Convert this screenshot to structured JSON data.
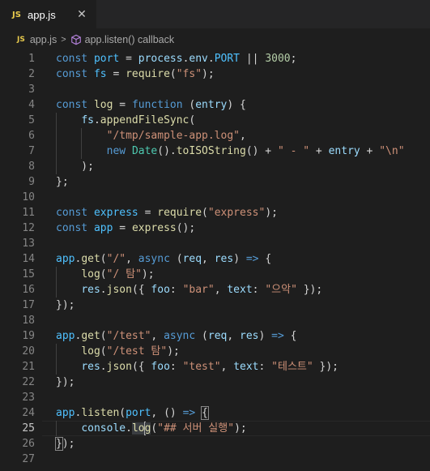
{
  "tab": {
    "badge": "JS",
    "filename": "app.js",
    "close": "✕"
  },
  "breadcrumb": {
    "badge": "JS",
    "file": "app.js",
    "separator": ">",
    "symbol": "app.listen() callback"
  },
  "colors": {
    "keyword": "#569cd6",
    "variable": "#9cdcfe",
    "constant": "#4fc1ff",
    "function": "#dcdcaa",
    "string": "#ce9178",
    "number": "#b5cea8",
    "type": "#4ec9b0"
  },
  "lines": [
    {
      "n": "1",
      "indent": 0,
      "tokens": [
        [
          "k",
          "const"
        ],
        [
          "p",
          " "
        ],
        [
          "c",
          "port"
        ],
        [
          "p",
          " = "
        ],
        [
          "v",
          "process"
        ],
        [
          "p",
          "."
        ],
        [
          "v",
          "env"
        ],
        [
          "p",
          "."
        ],
        [
          "c",
          "PORT"
        ],
        [
          "p",
          " || "
        ],
        [
          "n",
          "3000"
        ],
        [
          "p",
          ";"
        ]
      ]
    },
    {
      "n": "2",
      "indent": 0,
      "tokens": [
        [
          "k",
          "const"
        ],
        [
          "p",
          " "
        ],
        [
          "c",
          "fs"
        ],
        [
          "p",
          " = "
        ],
        [
          "f",
          "require"
        ],
        [
          "p",
          "("
        ],
        [
          "s",
          "\"fs\""
        ],
        [
          "p",
          ");"
        ]
      ]
    },
    {
      "n": "3",
      "indent": 0,
      "tokens": []
    },
    {
      "n": "4",
      "indent": 0,
      "tokens": [
        [
          "k",
          "const"
        ],
        [
          "p",
          " "
        ],
        [
          "f",
          "log"
        ],
        [
          "p",
          " = "
        ],
        [
          "k",
          "function"
        ],
        [
          "p",
          " ("
        ],
        [
          "v",
          "entry"
        ],
        [
          "p",
          ") {"
        ]
      ]
    },
    {
      "n": "5",
      "indent": 1,
      "tokens": [
        [
          "p",
          "    "
        ],
        [
          "v",
          "fs"
        ],
        [
          "p",
          "."
        ],
        [
          "f",
          "appendFileSync"
        ],
        [
          "p",
          "("
        ]
      ]
    },
    {
      "n": "6",
      "indent": 2,
      "tokens": [
        [
          "p",
          "        "
        ],
        [
          "s",
          "\"/tmp/sample-app.log\""
        ],
        [
          "p",
          ","
        ]
      ]
    },
    {
      "n": "7",
      "indent": 2,
      "tokens": [
        [
          "p",
          "        "
        ],
        [
          "k",
          "new"
        ],
        [
          "p",
          " "
        ],
        [
          "t",
          "Date"
        ],
        [
          "p",
          "()."
        ],
        [
          "f",
          "toISOString"
        ],
        [
          "p",
          "() + "
        ],
        [
          "s",
          "\" - \""
        ],
        [
          "p",
          " + "
        ],
        [
          "v",
          "entry"
        ],
        [
          "p",
          " + "
        ],
        [
          "s",
          "\"\\n\""
        ]
      ]
    },
    {
      "n": "8",
      "indent": 1,
      "tokens": [
        [
          "p",
          "    );"
        ]
      ]
    },
    {
      "n": "9",
      "indent": 0,
      "tokens": [
        [
          "p",
          "};"
        ]
      ]
    },
    {
      "n": "10",
      "indent": 0,
      "tokens": []
    },
    {
      "n": "11",
      "indent": 0,
      "tokens": [
        [
          "k",
          "const"
        ],
        [
          "p",
          " "
        ],
        [
          "c",
          "express"
        ],
        [
          "p",
          " = "
        ],
        [
          "f",
          "require"
        ],
        [
          "p",
          "("
        ],
        [
          "s",
          "\"express\""
        ],
        [
          "p",
          ");"
        ]
      ]
    },
    {
      "n": "12",
      "indent": 0,
      "tokens": [
        [
          "k",
          "const"
        ],
        [
          "p",
          " "
        ],
        [
          "c",
          "app"
        ],
        [
          "p",
          " = "
        ],
        [
          "f",
          "express"
        ],
        [
          "p",
          "();"
        ]
      ]
    },
    {
      "n": "13",
      "indent": 0,
      "tokens": []
    },
    {
      "n": "14",
      "indent": 0,
      "tokens": [
        [
          "c",
          "app"
        ],
        [
          "p",
          "."
        ],
        [
          "f",
          "get"
        ],
        [
          "p",
          "("
        ],
        [
          "s",
          "\"/\""
        ],
        [
          "p",
          ", "
        ],
        [
          "k",
          "async"
        ],
        [
          "p",
          " ("
        ],
        [
          "v",
          "req"
        ],
        [
          "p",
          ", "
        ],
        [
          "v",
          "res"
        ],
        [
          "p",
          ") "
        ],
        [
          "k",
          "=>"
        ],
        [
          "p",
          " {"
        ]
      ]
    },
    {
      "n": "15",
      "indent": 1,
      "tokens": [
        [
          "p",
          "    "
        ],
        [
          "f",
          "log"
        ],
        [
          "p",
          "("
        ],
        [
          "s",
          "\"/ 탐\""
        ],
        [
          "p",
          ");"
        ]
      ]
    },
    {
      "n": "16",
      "indent": 1,
      "tokens": [
        [
          "p",
          "    "
        ],
        [
          "v",
          "res"
        ],
        [
          "p",
          "."
        ],
        [
          "f",
          "json"
        ],
        [
          "p",
          "({ "
        ],
        [
          "v",
          "foo"
        ],
        [
          "p",
          ": "
        ],
        [
          "s",
          "\"bar\""
        ],
        [
          "p",
          ", "
        ],
        [
          "v",
          "text"
        ],
        [
          "p",
          ": "
        ],
        [
          "s",
          "\"으악\""
        ],
        [
          "p",
          " });"
        ]
      ]
    },
    {
      "n": "17",
      "indent": 0,
      "tokens": [
        [
          "p",
          "});"
        ]
      ]
    },
    {
      "n": "18",
      "indent": 0,
      "tokens": []
    },
    {
      "n": "19",
      "indent": 0,
      "tokens": [
        [
          "c",
          "app"
        ],
        [
          "p",
          "."
        ],
        [
          "f",
          "get"
        ],
        [
          "p",
          "("
        ],
        [
          "s",
          "\"/test\""
        ],
        [
          "p",
          ", "
        ],
        [
          "k",
          "async"
        ],
        [
          "p",
          " ("
        ],
        [
          "v",
          "req"
        ],
        [
          "p",
          ", "
        ],
        [
          "v",
          "res"
        ],
        [
          "p",
          ") "
        ],
        [
          "k",
          "=>"
        ],
        [
          "p",
          " {"
        ]
      ]
    },
    {
      "n": "20",
      "indent": 1,
      "tokens": [
        [
          "p",
          "    "
        ],
        [
          "f",
          "log"
        ],
        [
          "p",
          "("
        ],
        [
          "s",
          "\"/test 탐\""
        ],
        [
          "p",
          ");"
        ]
      ]
    },
    {
      "n": "21",
      "indent": 1,
      "tokens": [
        [
          "p",
          "    "
        ],
        [
          "v",
          "res"
        ],
        [
          "p",
          "."
        ],
        [
          "f",
          "json"
        ],
        [
          "p",
          "({ "
        ],
        [
          "v",
          "foo"
        ],
        [
          "p",
          ": "
        ],
        [
          "s",
          "\"test\""
        ],
        [
          "p",
          ", "
        ],
        [
          "v",
          "text"
        ],
        [
          "p",
          ": "
        ],
        [
          "s",
          "\"테스트\""
        ],
        [
          "p",
          " });"
        ]
      ]
    },
    {
      "n": "22",
      "indent": 0,
      "tokens": [
        [
          "p",
          "});"
        ]
      ]
    },
    {
      "n": "23",
      "indent": 0,
      "tokens": []
    },
    {
      "n": "24",
      "indent": 0,
      "tokens": [
        [
          "c",
          "app"
        ],
        [
          "p",
          "."
        ],
        [
          "f",
          "listen"
        ],
        [
          "p",
          "("
        ],
        [
          "c",
          "port"
        ],
        [
          "p",
          ", () "
        ],
        [
          "k",
          "=>"
        ],
        [
          "p",
          " "
        ],
        [
          "bh",
          "{"
        ]
      ]
    },
    {
      "n": "25",
      "indent": 1,
      "current": true,
      "tokens": [
        [
          "p",
          "    "
        ],
        [
          "v",
          "console"
        ],
        [
          "p",
          "."
        ],
        [
          "fw",
          "lo"
        ],
        [
          "cur",
          ""
        ],
        [
          "fw",
          "g"
        ],
        [
          "p",
          "("
        ],
        [
          "s",
          "\"## 서버 실행\""
        ],
        [
          "p",
          ");"
        ]
      ]
    },
    {
      "n": "26",
      "indent": 0,
      "tokens": [
        [
          "bh",
          "}"
        ],
        [
          "p",
          ");"
        ]
      ]
    },
    {
      "n": "27",
      "indent": 0,
      "tokens": []
    }
  ]
}
